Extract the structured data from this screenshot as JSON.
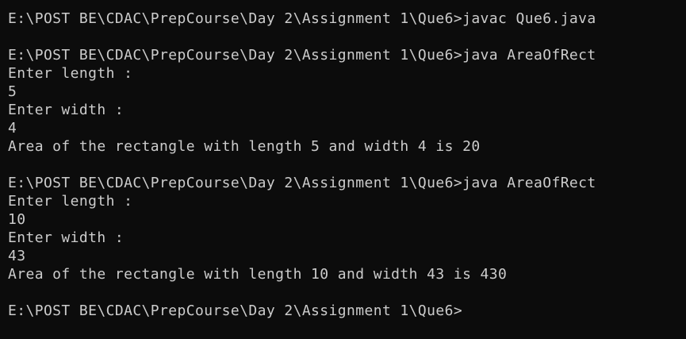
{
  "lines": [
    "E:\\POST BE\\CDAC\\PrepCourse\\Day 2\\Assignment 1\\Que6>javac Que6.java",
    "",
    "E:\\POST BE\\CDAC\\PrepCourse\\Day 2\\Assignment 1\\Que6>java AreaOfRect",
    "Enter length :",
    "5",
    "Enter width :",
    "4",
    "Area of the rectangle with length 5 and width 4 is 20",
    "",
    "E:\\POST BE\\CDAC\\PrepCourse\\Day 2\\Assignment 1\\Que6>java AreaOfRect",
    "Enter length :",
    "10",
    "Enter width :",
    "43",
    "Area of the rectangle with length 10 and width 43 is 430",
    "",
    "E:\\POST BE\\CDAC\\PrepCourse\\Day 2\\Assignment 1\\Que6>"
  ]
}
